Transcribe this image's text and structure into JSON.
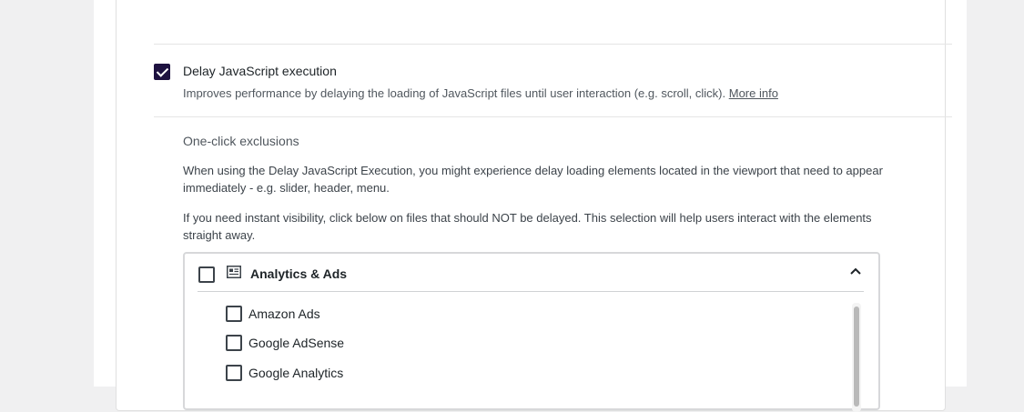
{
  "delay_js": {
    "checked": true,
    "title": "Delay JavaScript execution",
    "description": "Improves performance by delaying the loading of JavaScript files until user interaction (e.g. scroll, click).",
    "more_info_label": "More info"
  },
  "exclusions": {
    "title": "One-click exclusions",
    "paragraph1": "When using the Delay JavaScript Execution, you might experience delay loading elements located in the viewport that need to appear immediately - e.g. slider, header, menu.",
    "paragraph2": "If you need instant visibility, click below on files that should NOT be delayed. This selection will help users interact with the elements straight away.",
    "category": {
      "label": "Analytics & Ads",
      "icon": "analytics-ads-icon",
      "expanded": true,
      "items": [
        {
          "label": "Amazon Ads",
          "checked": false
        },
        {
          "label": "Google AdSense",
          "checked": false
        },
        {
          "label": "Google Analytics",
          "checked": false
        }
      ]
    }
  },
  "colors": {
    "accent": "#1e1240"
  }
}
